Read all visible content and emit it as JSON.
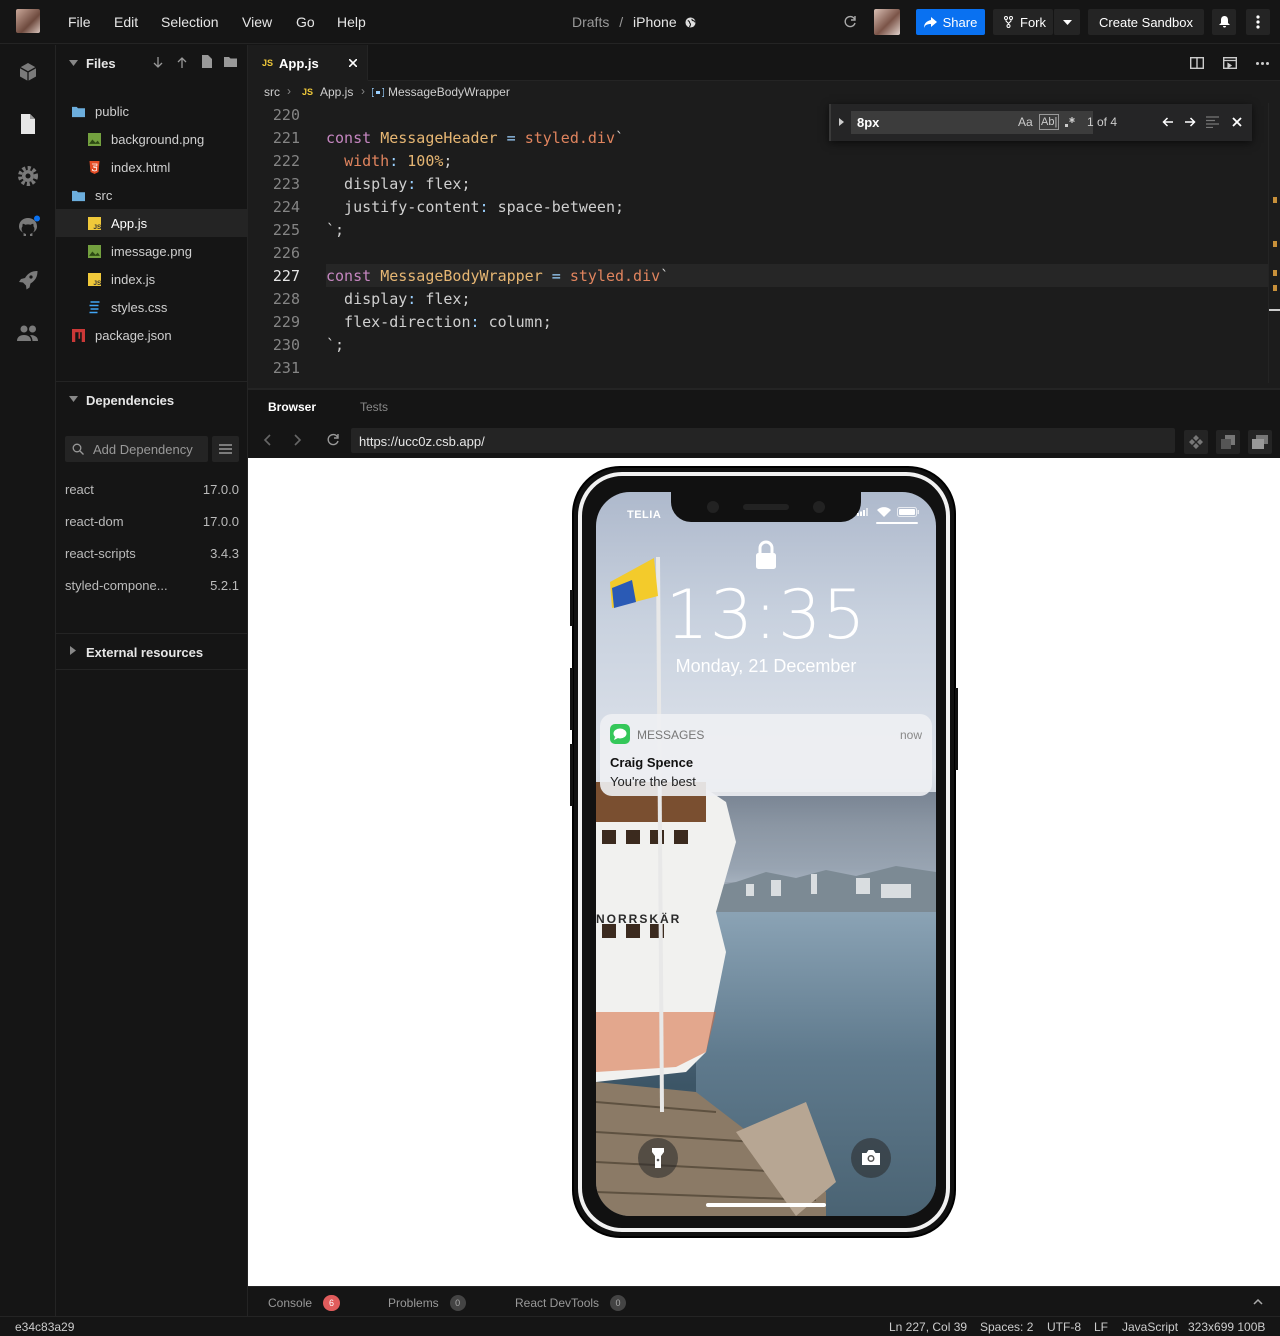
{
  "menu": [
    "File",
    "Edit",
    "Selection",
    "View",
    "Go",
    "Help"
  ],
  "breadcrumb": {
    "parent": "Drafts",
    "separator": "/",
    "current": "iPhone"
  },
  "toolbar": {
    "share": "Share",
    "fork": "Fork",
    "create": "Create Sandbox",
    "accent": "#0971f1"
  },
  "sidebar": {
    "files_title": "Files",
    "tree": [
      {
        "label": "public",
        "icon": "folder-icon",
        "depth": 0
      },
      {
        "label": "background.png",
        "icon": "image-file-icon",
        "depth": 1
      },
      {
        "label": "index.html",
        "icon": "html-file-icon",
        "depth": 1
      },
      {
        "label": "src",
        "icon": "folder-icon",
        "depth": 0
      },
      {
        "label": "App.js",
        "icon": "js-file-icon",
        "depth": 1,
        "selected": true
      },
      {
        "label": "imessage.png",
        "icon": "image-file-icon",
        "depth": 1
      },
      {
        "label": "index.js",
        "icon": "js-file-icon",
        "depth": 1
      },
      {
        "label": "styles.css",
        "icon": "css-file-icon",
        "depth": 1
      },
      {
        "label": "package.json",
        "icon": "npm-file-icon",
        "depth": 0
      }
    ],
    "deps_title": "Dependencies",
    "add_dep_placeholder": "Add Dependency",
    "deps": [
      {
        "name": "react",
        "version": "17.0.0"
      },
      {
        "name": "react-dom",
        "version": "17.0.0"
      },
      {
        "name": "react-scripts",
        "version": "3.4.3"
      },
      {
        "name": "styled-compone...",
        "version": "5.2.1"
      }
    ],
    "external_title": "External resources"
  },
  "editor": {
    "tab_badge": "JS",
    "tab_label": "App.js",
    "breadcrumb": {
      "folder": "src",
      "file": "App.js",
      "symbol": "MessageBodyWrapper"
    },
    "current_line": "227",
    "lines": [
      {
        "n": "220",
        "parts": []
      },
      {
        "n": "221",
        "parts": [
          [
            "k",
            "const "
          ],
          [
            "n",
            "MessageHeader"
          ],
          [
            "o",
            " = "
          ],
          [
            "s",
            "styled.div"
          ],
          [
            "p",
            "`"
          ]
        ]
      },
      {
        "n": "222",
        "parts": [
          [
            "p",
            "  "
          ],
          [
            "s",
            "width"
          ],
          [
            "o",
            ": "
          ],
          [
            "n",
            "100%"
          ],
          [
            "p",
            ";"
          ]
        ]
      },
      {
        "n": "223",
        "parts": [
          [
            "p",
            "  display"
          ],
          [
            "o",
            ": "
          ],
          [
            "p",
            "flex;"
          ]
        ]
      },
      {
        "n": "224",
        "parts": [
          [
            "p",
            "  justify-content"
          ],
          [
            "o",
            ": "
          ],
          [
            "p",
            "space-between;"
          ]
        ]
      },
      {
        "n": "225",
        "parts": [
          [
            "p",
            "`;"
          ]
        ]
      },
      {
        "n": "226",
        "parts": []
      },
      {
        "n": "227",
        "parts": [
          [
            "k",
            "const "
          ],
          [
            "n",
            "MessageBodyWrapper"
          ],
          [
            "o",
            " = "
          ],
          [
            "s",
            "styled.div"
          ],
          [
            "p",
            "`"
          ]
        ]
      },
      {
        "n": "228",
        "parts": [
          [
            "p",
            "  display"
          ],
          [
            "o",
            ": "
          ],
          [
            "p",
            "flex;"
          ]
        ]
      },
      {
        "n": "229",
        "parts": [
          [
            "p",
            "  flex-direction"
          ],
          [
            "o",
            ": "
          ],
          [
            "p",
            "column;"
          ]
        ]
      },
      {
        "n": "230",
        "parts": [
          [
            "p",
            "`;"
          ]
        ]
      },
      {
        "n": "231",
        "parts": []
      }
    ],
    "find": {
      "query": "8px",
      "case": "Aa",
      "word": "Ab|",
      "result": "1 of 4"
    }
  },
  "preview": {
    "tabs": [
      "Browser",
      "Tests"
    ],
    "active_tab": "Browser",
    "url": "https://ucc0z.csb.app/"
  },
  "lockscreen": {
    "carrier": "TELIA",
    "time": "13:35",
    "date": "Monday, 21 December",
    "notification": {
      "app": "MESSAGES",
      "when": "now",
      "sender": "Craig Spence",
      "body": "You're the best"
    },
    "ship_name": "NORRSKÄR"
  },
  "bottom_tabs": [
    {
      "label": "Console",
      "count": "6",
      "badge_color": "#e05c5c"
    },
    {
      "label": "Problems",
      "count": "0",
      "badge_color": "#444444"
    },
    {
      "label": "React DevTools",
      "count": "0",
      "badge_color": "#444444"
    }
  ],
  "status": {
    "commit": "e34c83a29",
    "position": "Ln 227, Col 39",
    "spaces": "Spaces: 2",
    "encoding": "UTF-8",
    "eol": "LF",
    "language": "JavaScript",
    "size": "323x699 100B"
  }
}
